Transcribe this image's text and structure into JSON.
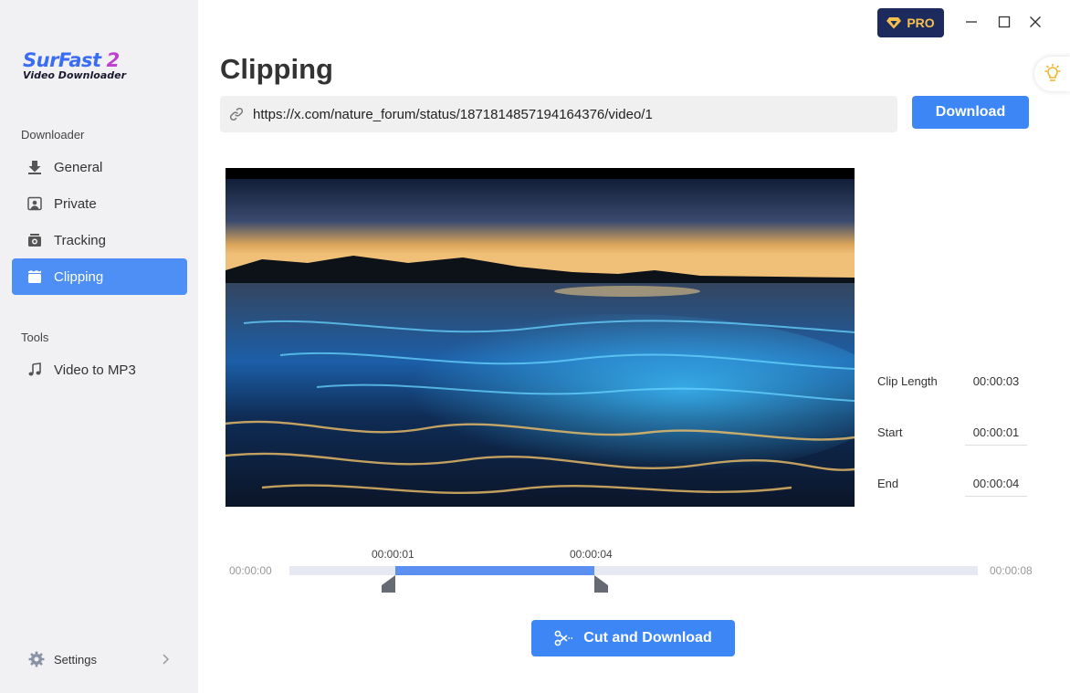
{
  "app": {
    "logo_title": "SurFast",
    "logo_version": "2",
    "logo_subtitle": "Video Downloader"
  },
  "sidebar": {
    "downloader_label": "Downloader",
    "tools_label": "Tools",
    "items": [
      {
        "label": "General",
        "icon": "download-icon"
      },
      {
        "label": "Private",
        "icon": "private-icon"
      },
      {
        "label": "Tracking",
        "icon": "tracking-icon"
      },
      {
        "label": "Clipping",
        "icon": "clipping-icon",
        "active": true
      }
    ],
    "tools": [
      {
        "label": "Video to MP3",
        "icon": "music-note-icon"
      }
    ],
    "settings_label": "Settings"
  },
  "header": {
    "pro_label": "PRO"
  },
  "main": {
    "title": "Clipping",
    "url_value": "https://x.com/nature_forum/status/1871814857194164376/video/1",
    "download_label": "Download",
    "clip_length_label": "Clip Length",
    "clip_length_value": "00:00:03",
    "start_label": "Start",
    "start_value": "00:00:01",
    "end_label": "End",
    "end_value": "00:00:04",
    "timeline": {
      "start_time": "00:00:00",
      "end_time": "00:00:08",
      "handle_start_label": "00:00:01",
      "handle_end_label": "00:00:04",
      "selection_start_fraction": 0.125,
      "selection_end_fraction": 0.5
    },
    "cut_download_label": "Cut and Download"
  },
  "colors": {
    "accent": "#3d86f5",
    "active_nav": "#4d8ff5",
    "pro_bg": "#1d2a5e",
    "pro_text": "#f5c04d"
  }
}
